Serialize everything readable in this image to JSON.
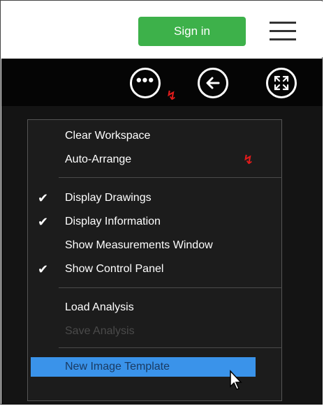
{
  "header": {
    "sign_in_label": "Sign in"
  },
  "menu": {
    "items": [
      {
        "label": "Clear Workspace",
        "checked": false,
        "enabled": true
      },
      {
        "label": "Auto-Arrange",
        "checked": false,
        "enabled": true
      },
      {
        "label": "Display Drawings",
        "checked": true,
        "enabled": true
      },
      {
        "label": "Display Information",
        "checked": true,
        "enabled": true
      },
      {
        "label": "Show Measurements Window",
        "checked": false,
        "enabled": true
      },
      {
        "label": "Show Control Panel",
        "checked": true,
        "enabled": true
      },
      {
        "label": "Load Analysis",
        "checked": false,
        "enabled": true
      },
      {
        "label": "Save Analysis",
        "checked": false,
        "enabled": false
      },
      {
        "label": "New Image Template",
        "checked": false,
        "enabled": true,
        "highlighted": true
      }
    ],
    "check_glyph": "✔"
  },
  "icons": {
    "more": "more-options-icon",
    "back": "back-arrow-icon",
    "expand": "fullscreen-icon",
    "menu": "hamburger-menu-icon"
  },
  "colors": {
    "sign_in_bg": "#3db14a",
    "highlight_bg": "#3a93ea",
    "annotation_red": "#e01b1b"
  }
}
